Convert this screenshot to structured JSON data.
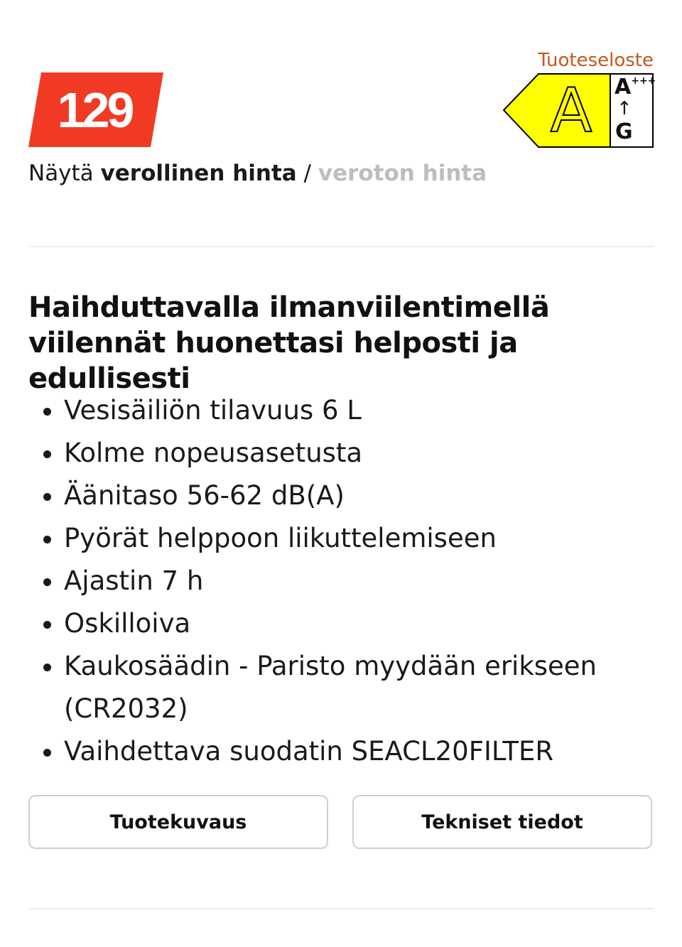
{
  "price": {
    "value": "129",
    "badge_color": "#f03a24",
    "toggle_prefix": "Näytä ",
    "with_tax_label": "verollinen hinta",
    "separator": " / ",
    "without_tax_label": "veroton hinta"
  },
  "energy": {
    "link_label": "Tuoteseloste",
    "class": "A",
    "scale_top": "A",
    "scale_top_sup": "+++",
    "scale_arrow": "↑",
    "scale_bottom": "G",
    "label_color": "#ffff00"
  },
  "description": {
    "heading": "Haihduttavalla ilmanviilentimellä viilennät huonettasi helposti ja edullisesti",
    "features": [
      "Vesisäiliön tilavuus 6 L",
      "Kolme nopeusasetusta",
      "Äänitaso 56-62 dB(A)",
      "Pyörät helppoon liikuttelemiseen",
      "Ajastin 7 h",
      "Oskilloiva",
      "Kaukosäädin - Paristo myydään erikseen (CR2032)",
      "Vaihdettava suodatin SEACL20FILTER"
    ]
  },
  "buttons": {
    "description_label": "Tuotekuvaus",
    "specs_label": "Tekniset tiedot"
  }
}
